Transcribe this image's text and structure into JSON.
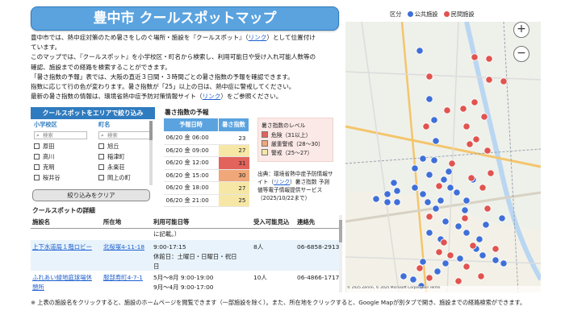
{
  "title": "豊中市 クールスポットマップ",
  "intro": {
    "line1_before": "豊中市では、熱中症対策のため暑さをしのぐ場所・施設を『クールスポット』（",
    "link1": "リンク",
    "line1_after": "）として位置付け",
    "line2": "ています。",
    "line3": "このマップでは、『クールスポット』を小学校区・町名から検索し、利用可能日や受け入れ可能人数等の",
    "line4": "確認、施設までの経路を検索することができます。",
    "line5": "「暑さ指数の予報」表では、大阪の直近３日間・３時間ごとの暑さ指数の予報を確認できます。",
    "line6": "指数に応じて行の色が変わります。暑さ指数が「25」以上の日は、熱中症に警戒してください。",
    "line7_before": "最新の暑さ指数の情報は、環境省熱中症予防対策情報サイト（",
    "link2": "リンク",
    "line7_after": "）をご参照ください。"
  },
  "filter": {
    "header": "クールスポットをエリアで絞り込み",
    "school": {
      "title": "小学校区",
      "placeholder": "検索",
      "options": [
        "原田",
        "高川",
        "克明",
        "桜井谷"
      ]
    },
    "town": {
      "title": "町名",
      "placeholder": "検索",
      "options": [
        "旭丘",
        "稲津町",
        "永楽荘",
        "岡上の町"
      ]
    },
    "clear_button": "絞り込みをクリア"
  },
  "forecast": {
    "title": "暑さ指数の予報",
    "col_time": "予報日時",
    "col_index": "暑さ指数",
    "rows": [
      {
        "time": "06/20 金 06:00",
        "value": "23",
        "level": "none"
      },
      {
        "time": "06/20 金 09:00",
        "value": "27",
        "level": "warn"
      },
      {
        "time": "06/20 金 12:00",
        "value": "31",
        "level": "danger"
      },
      {
        "time": "06/20 金 15:00",
        "value": "30",
        "level": "severe"
      },
      {
        "time": "06/20 金 18:00",
        "value": "27",
        "level": "warn"
      },
      {
        "time": "06/20 金 21:00",
        "value": "25",
        "level": "warn"
      }
    ]
  },
  "levels": {
    "title": "暑さ指数のレベル",
    "items": [
      {
        "label": "危険（31以上）",
        "color": "#e2635c"
      },
      {
        "label": "厳重警戒（28〜30）",
        "color": "#f0a779"
      },
      {
        "label": "警戒（25〜27）",
        "color": "#f7e7a6"
      }
    ]
  },
  "source": {
    "line1": "出典：環境省熱中症予防情報サ",
    "line2_before": "イト（",
    "link": "リンク",
    "line2_after": "）暑さ指数 予測",
    "line3": "値等電子情報提供サービス",
    "line4": "（2025/10/22まで）"
  },
  "list": {
    "title": "クールスポットの詳細",
    "headers": {
      "name": "施設名",
      "address": "所在地",
      "dates": "利用可能日等",
      "capacity": "受入可能見込",
      "contact": "連絡先"
    },
    "partial_text": "に記載。）",
    "rows": [
      {
        "name": "上下水道局１階ロビー",
        "address": "北桜塚4-11-18",
        "dates1": "9:00-17:15",
        "dates2": "休館日：土曜日・日曜日・祝日",
        "dates3": "日",
        "capacity": "8人",
        "contact": "06-6858-2913"
      },
      {
        "name1": "ふれあい緑地庭球場休",
        "name2": "憩所",
        "address": "服部寿町4-7-1",
        "dates1": "5月〜8月 9:00-19:00",
        "dates2": "9月〜4月 9:00-17:00",
        "capacity": "10人",
        "contact": "06-4866-1717"
      }
    ]
  },
  "footnote": "※ 上表の施設名をクリックすると、施設のホームページを閲覧できます（一部施設を除く）。また、所在地をクリックすると、Google Mapが別タブで開き、施設までの経路検索ができます。",
  "map": {
    "legend_title": "区分",
    "legend_public": "公共施設",
    "legend_private": "民間施設",
    "public_color": "#3f6fd8",
    "private_color": "#e0534f",
    "zoom_in": "+",
    "zoom_out": "−",
    "attribution": "© 2025 Zenrin, © 2025 Microsoft Corporation  Terms"
  }
}
